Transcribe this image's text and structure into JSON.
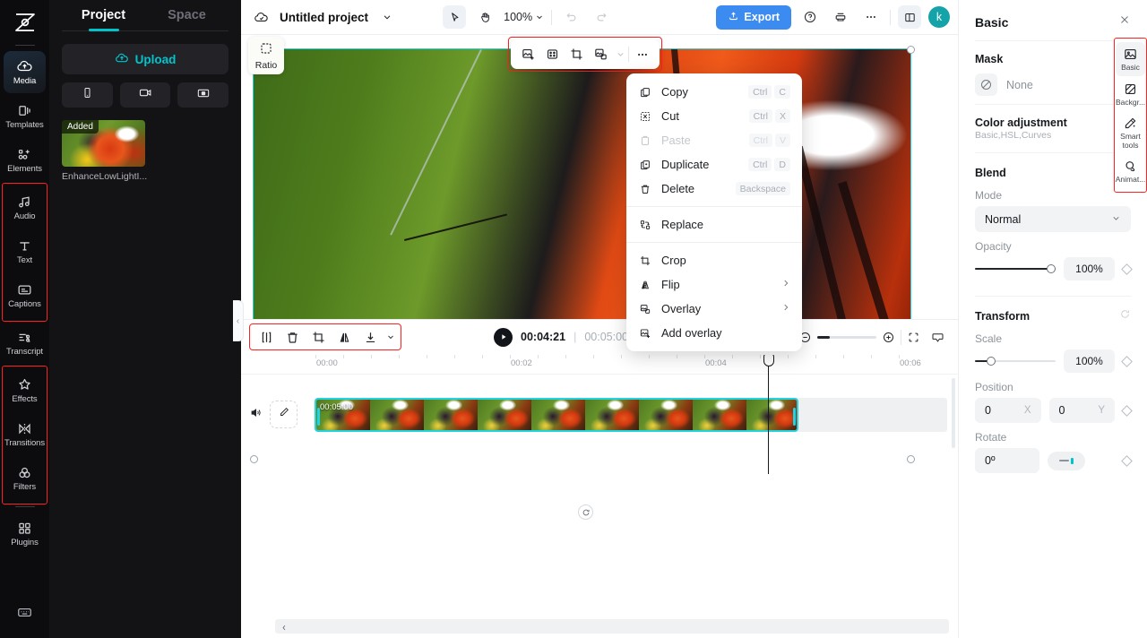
{
  "app": {
    "brand": "capcut-logo"
  },
  "icon_rail": {
    "items": [
      {
        "label": "Media",
        "icon": "cloud-upload-icon",
        "active": true
      },
      {
        "label": "Templates",
        "icon": "templates-icon",
        "active": false
      },
      {
        "label": "Elements",
        "icon": "elements-icon",
        "active": false
      },
      {
        "label": "Audio",
        "icon": "audio-note-icon",
        "active": false
      },
      {
        "label": "Text",
        "icon": "text-icon",
        "active": false
      },
      {
        "label": "Captions",
        "icon": "captions-icon",
        "active": false
      },
      {
        "label": "Transcript",
        "icon": "transcript-icon",
        "active": false
      },
      {
        "label": "Effects",
        "icon": "effects-star-icon",
        "active": false
      },
      {
        "label": "Transitions",
        "icon": "transitions-icon",
        "active": false
      },
      {
        "label": "Filters",
        "icon": "filters-circles-icon",
        "active": false
      },
      {
        "label": "Plugins",
        "icon": "plugins-grid-icon",
        "active": false
      }
    ],
    "bottom_icon": "keyboard-shortcuts-icon"
  },
  "media_panel": {
    "tabs": [
      {
        "label": "Project",
        "active": true
      },
      {
        "label": "Space",
        "active": false
      }
    ],
    "upload_label": "Upload",
    "source_buttons": [
      {
        "icon": "phone-icon"
      },
      {
        "icon": "camera-icon"
      },
      {
        "icon": "screen-record-icon"
      }
    ],
    "media_items": [
      {
        "badge": "Added",
        "name": "EnhanceLowLightI..."
      }
    ]
  },
  "topbar": {
    "cloud_icon": "cloud-icon",
    "project_title": "Untitled project",
    "title_caret": "chevron-down-icon",
    "select_tool_icon": "cursor-select-icon",
    "hand_tool_icon": "hand-pan-icon",
    "zoom_level": "100%",
    "undo_icon": "undo-icon",
    "redo_icon": "redo-icon",
    "export_label": "Export",
    "help_icon": "help-circle-icon",
    "print_icon": "print-icon",
    "more_icon": "more-horizontal-icon",
    "layout_icon": "panel-layout-icon",
    "avatar_initial": "k"
  },
  "stage": {
    "ratio_button": {
      "label": "Ratio",
      "icon": "ratio-dashed-icon"
    },
    "collapse_handle_icon": "chevron-left-icon",
    "element_toolbar": [
      {
        "icon": "add-overlay-icon"
      },
      {
        "icon": "mask-icon"
      },
      {
        "icon": "crop-icon"
      },
      {
        "icon": "overlay-icon"
      },
      {
        "icon": "chevron-down-icon"
      },
      {
        "icon": "more-horizontal-icon"
      }
    ],
    "rotate_handle_icon": "rotate-icon"
  },
  "context_menu": {
    "items": [
      {
        "label": "Copy",
        "icon": "copy-icon",
        "keys": [
          "Ctrl",
          "C"
        ],
        "disabled": false,
        "submenu": false
      },
      {
        "label": "Cut",
        "icon": "cut-icon",
        "keys": [
          "Ctrl",
          "X"
        ],
        "disabled": false,
        "submenu": false
      },
      {
        "label": "Paste",
        "icon": "paste-icon",
        "keys": [
          "Ctrl",
          "V"
        ],
        "disabled": true,
        "submenu": false
      },
      {
        "label": "Duplicate",
        "icon": "duplicate-icon",
        "keys": [
          "Ctrl",
          "D"
        ],
        "disabled": false,
        "submenu": false
      },
      {
        "label": "Delete",
        "icon": "trash-icon",
        "keys": [
          "Backspace"
        ],
        "disabled": false,
        "submenu": false
      },
      {
        "separator": true
      },
      {
        "label": "Replace",
        "icon": "replace-icon",
        "keys": [],
        "disabled": false,
        "submenu": false
      },
      {
        "separator": true
      },
      {
        "label": "Crop",
        "icon": "crop-icon",
        "keys": [],
        "disabled": false,
        "submenu": false
      },
      {
        "label": "Flip",
        "icon": "flip-icon",
        "keys": [],
        "disabled": false,
        "submenu": true
      },
      {
        "label": "Overlay",
        "icon": "overlay-icon",
        "keys": [],
        "disabled": false,
        "submenu": true
      },
      {
        "label": "Add overlay",
        "icon": "add-overlay-icon",
        "keys": [],
        "disabled": false,
        "submenu": false
      }
    ]
  },
  "timeline_toolbar": {
    "left_tools": [
      {
        "icon": "split-icon"
      },
      {
        "icon": "delete-trash-icon"
      },
      {
        "icon": "crop-icon"
      },
      {
        "icon": "mirror-flip-icon"
      },
      {
        "icon": "download-icon"
      },
      {
        "icon": "chevron-down-icon"
      }
    ],
    "play_icon": "play-icon",
    "current_time": "00:04:21",
    "time_divider": "|",
    "total_time": "00:05:00",
    "right_tools": [
      {
        "icon": "microphone-icon",
        "highlighted": false
      },
      {
        "icon": "auto-captions-icon",
        "highlighted": true
      },
      {
        "icon": "split-marker-icon",
        "highlighted": false
      }
    ],
    "zoom_out_icon": "zoom-out-circle-icon",
    "zoom_in_icon": "zoom-in-circle-icon",
    "fit-icon": "fit-screen-icon",
    "preview_icon": "preview-monitor-icon"
  },
  "timeline": {
    "ruler_labels": [
      "00:00",
      "00:02",
      "00:04",
      "00:06"
    ],
    "track": {
      "mute_icon": "speaker-icon",
      "edit_icon": "pen-edit-icon",
      "clip_duration": "00:05:00"
    },
    "scroll_left_icon": "chevron-left-icon"
  },
  "properties": {
    "title": "Basic",
    "close_icon": "close-icon",
    "mask": {
      "title": "Mask",
      "value": "None",
      "icon": "mask-none-icon",
      "chevron": "chevron-right-icon"
    },
    "color_adjustment": {
      "title": "Color adjustment",
      "subtitle": "Basic,HSL,Curves",
      "chevron": "chevron-right-icon"
    },
    "blend": {
      "title": "Blend",
      "reset_icon": "reset-icon",
      "mode_label": "Mode",
      "mode_value": "Normal",
      "mode_caret": "chevron-down-icon",
      "opacity_label": "Opacity",
      "opacity_value": "100%",
      "opacity_percent": 100,
      "keyframe_icon": "keyframe-diamond-icon"
    },
    "transform": {
      "title": "Transform",
      "reset_icon": "reset-icon",
      "scale_label": "Scale",
      "scale_value": "100%",
      "scale_percent": 18,
      "position_label": "Position",
      "position_x": "0",
      "position_x_axis": "X",
      "position_y": "0",
      "position_y_axis": "Y",
      "rotate_label": "Rotate",
      "rotate_value": "0º",
      "keyframe_icon": "keyframe-diamond-icon"
    }
  },
  "tool_rail": {
    "items": [
      {
        "label": "Basic",
        "icon": "image-basic-icon",
        "active": true
      },
      {
        "label": "Backgr...",
        "icon": "background-icon",
        "active": false
      },
      {
        "label": "Smart tools",
        "icon": "magic-wand-icon",
        "active": false
      },
      {
        "label": "Animat...",
        "icon": "animation-icon",
        "active": false
      }
    ]
  },
  "colors": {
    "accent_cyan": "#00c4cc",
    "selection_cyan": "#22d3e0",
    "export_blue": "#3c8bf0",
    "highlight_red": "#ff2020",
    "avatar_teal": "#13a3a8"
  }
}
